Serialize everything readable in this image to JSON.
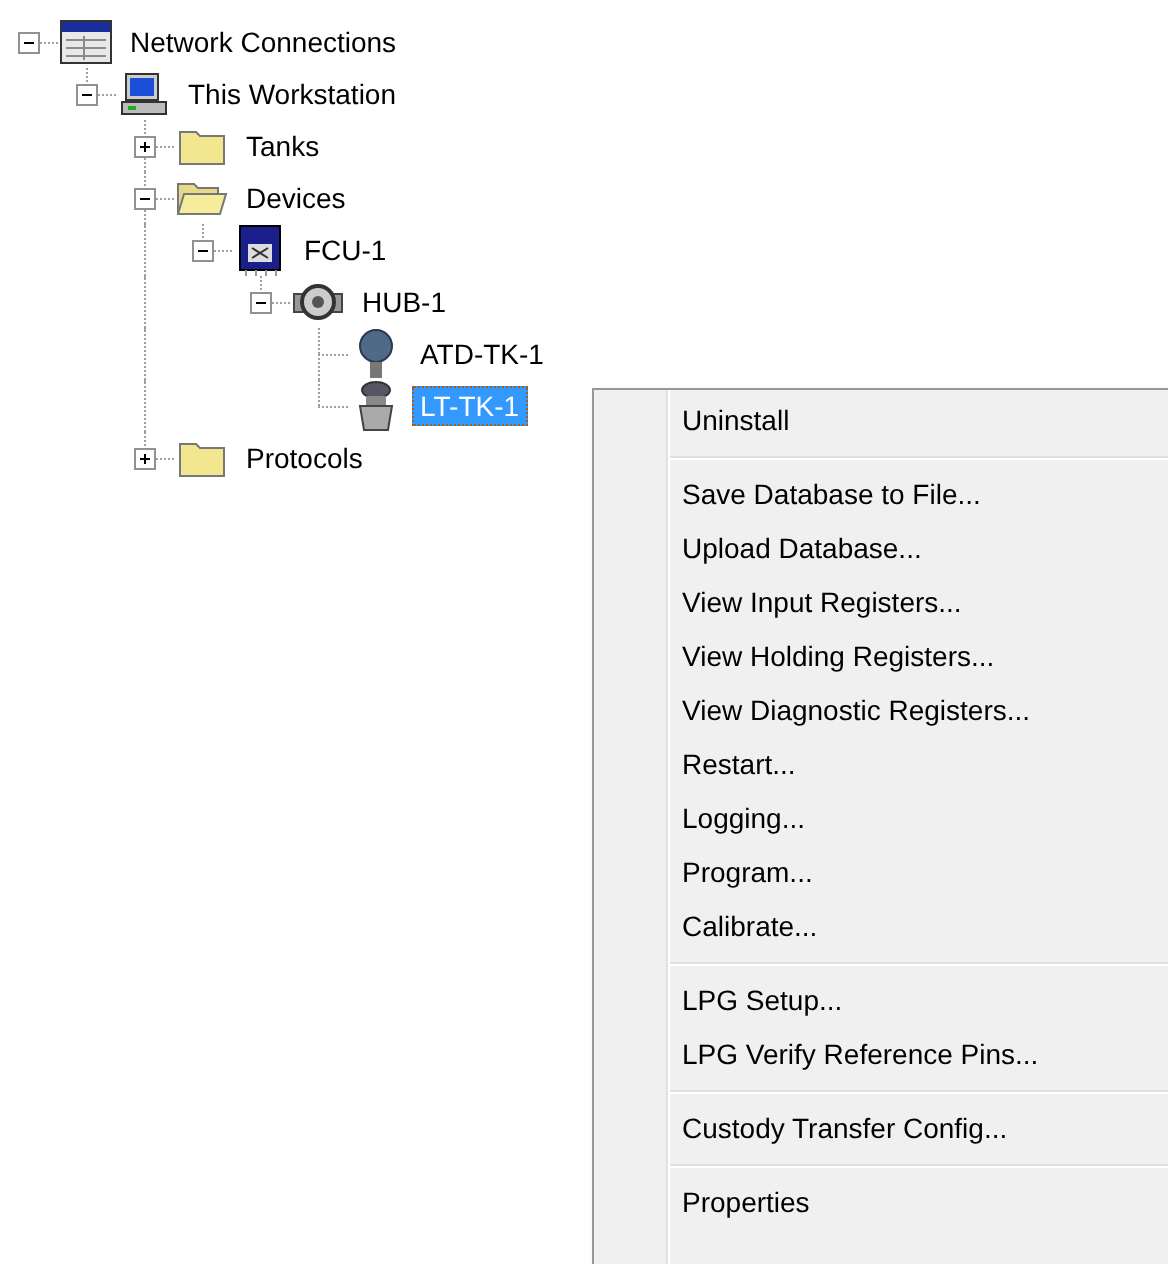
{
  "tree": [
    {
      "label": "Network Connections",
      "kind": "network",
      "expanded": true,
      "selected": false,
      "children": [
        {
          "label": "This Workstation",
          "kind": "computer",
          "expanded": true,
          "selected": false,
          "children": [
            {
              "label": "Tanks",
              "kind": "folder",
              "expanded": false,
              "selected": false
            },
            {
              "label": "Devices",
              "kind": "folder",
              "expanded": true,
              "selected": false,
              "children": [
                {
                  "label": "FCU-1",
                  "kind": "fcu",
                  "expanded": true,
                  "selected": false,
                  "children": [
                    {
                      "label": "HUB-1",
                      "kind": "hub",
                      "expanded": true,
                      "selected": false,
                      "children": [
                        {
                          "label": "ATD-TK-1",
                          "kind": "sensor",
                          "selected": false
                        },
                        {
                          "label": "LT-TK-1",
                          "kind": "level-gauge",
                          "selected": true
                        }
                      ]
                    }
                  ]
                }
              ]
            },
            {
              "label": "Protocols",
              "kind": "folder",
              "expanded": false,
              "selected": false
            }
          ]
        }
      ]
    }
  ],
  "context_menu": {
    "groups": [
      [
        "Uninstall"
      ],
      [
        "Save Database to File...",
        "Upload Database...",
        "View Input Registers...",
        "View Holding Registers...",
        "View Diagnostic Registers...",
        "Restart...",
        "Logging...",
        "Program...",
        "Calibrate..."
      ],
      [
        "LPG Setup...",
        "LPG Verify Reference Pins..."
      ],
      [
        "Custody Transfer Config..."
      ],
      [
        "Properties"
      ]
    ]
  }
}
